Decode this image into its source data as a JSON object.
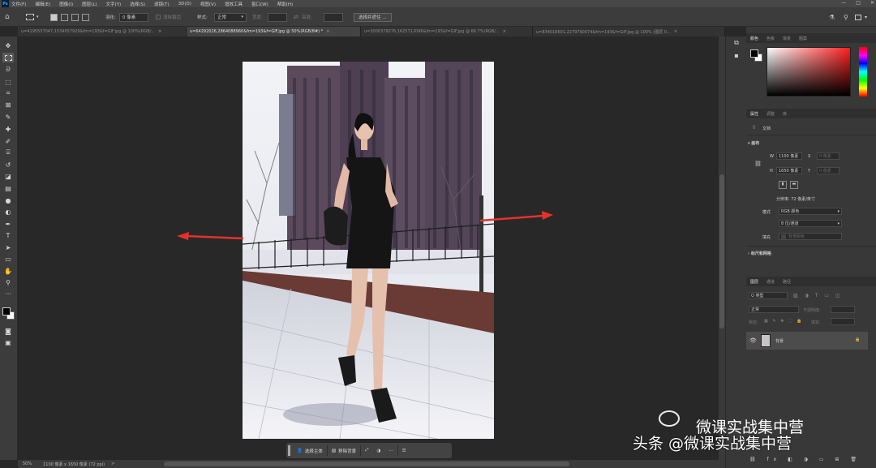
{
  "menubar": {
    "logo": "Ps",
    "items": [
      "文件(F)",
      "编辑(E)",
      "图像(I)",
      "图层(L)",
      "文字(Y)",
      "选择(S)",
      "滤镜(T)",
      "3D(D)",
      "视图(V)",
      "增效工具",
      "窗口(W)",
      "帮助(H)"
    ],
    "window_controls": [
      "—",
      "□",
      "✕"
    ]
  },
  "options": {
    "feather_label": "羽化:",
    "feather_value": "0 像素",
    "antialias_label": "消除锯齿",
    "style_label": "样式:",
    "style_value": "正常",
    "width_label": "宽度:",
    "height_label": "高度:",
    "select_and_mask": "选择并遮住 ..."
  },
  "tabs": [
    {
      "label": "u=4195537047,1534057929&fm=193&f=GIF.jpg @ 100%(RGB/..."
    },
    {
      "label": "u=64292026,2864088960&fm=193&f=GIF.jpg @ 50%(RGB/8#) *",
      "active": true
    },
    {
      "label": "u=3000378276,1625712096&fm=193&f=GIF.jpg @ 66.7%(RGB/..."
    },
    {
      "label": "u=834016601,2279790074&fm=193&f=GIF.jpg @ 100% (图层 0..."
    }
  ],
  "status": {
    "zoom": "50%",
    "doc_size": "1100 像素 x 1650 像素 (72 ppi)",
    "arrow": ">"
  },
  "taskbar": {
    "select_subject": "选择主体",
    "remove_background": "移除背景",
    "more": "···"
  },
  "color_panel": {
    "tabs": [
      "颜色",
      "色板",
      "渐变",
      "图案"
    ]
  },
  "properties": {
    "tabs": [
      "属性",
      "调整",
      "库"
    ],
    "doc_label": "文档",
    "canvas_section": "画布",
    "w_label": "W",
    "w_value": "1100 像素",
    "h_label": "H",
    "h_value": "1650 像素",
    "x_label": "X",
    "y_label": "Y",
    "x_placeholder": "0 像素",
    "y_placeholder": "0 像素",
    "resolution": "分辨率: 72 像素/英寸",
    "mode_label": "模式",
    "mode_value": "RGB 颜色",
    "depth_value": "8 位/通道",
    "fill_label": "填充",
    "fill_value": "背景颜色",
    "rulers_section": "标尺和网格"
  },
  "layers": {
    "tabs": [
      "图层",
      "通道",
      "路径"
    ],
    "kind_label": "Q 类型",
    "blend_mode": "正常",
    "opacity_label": "不透明度:",
    "lock_label": "锁定:",
    "fill_label": "填充:",
    "layer_name": "背景"
  },
  "watermark": {
    "line1": "微课实战集中营",
    "line2": "头条 @微课实战集中营"
  },
  "colors": {
    "arrow_red": "#e5312c",
    "bg_dark": "#282828",
    "panel": "#383838"
  }
}
